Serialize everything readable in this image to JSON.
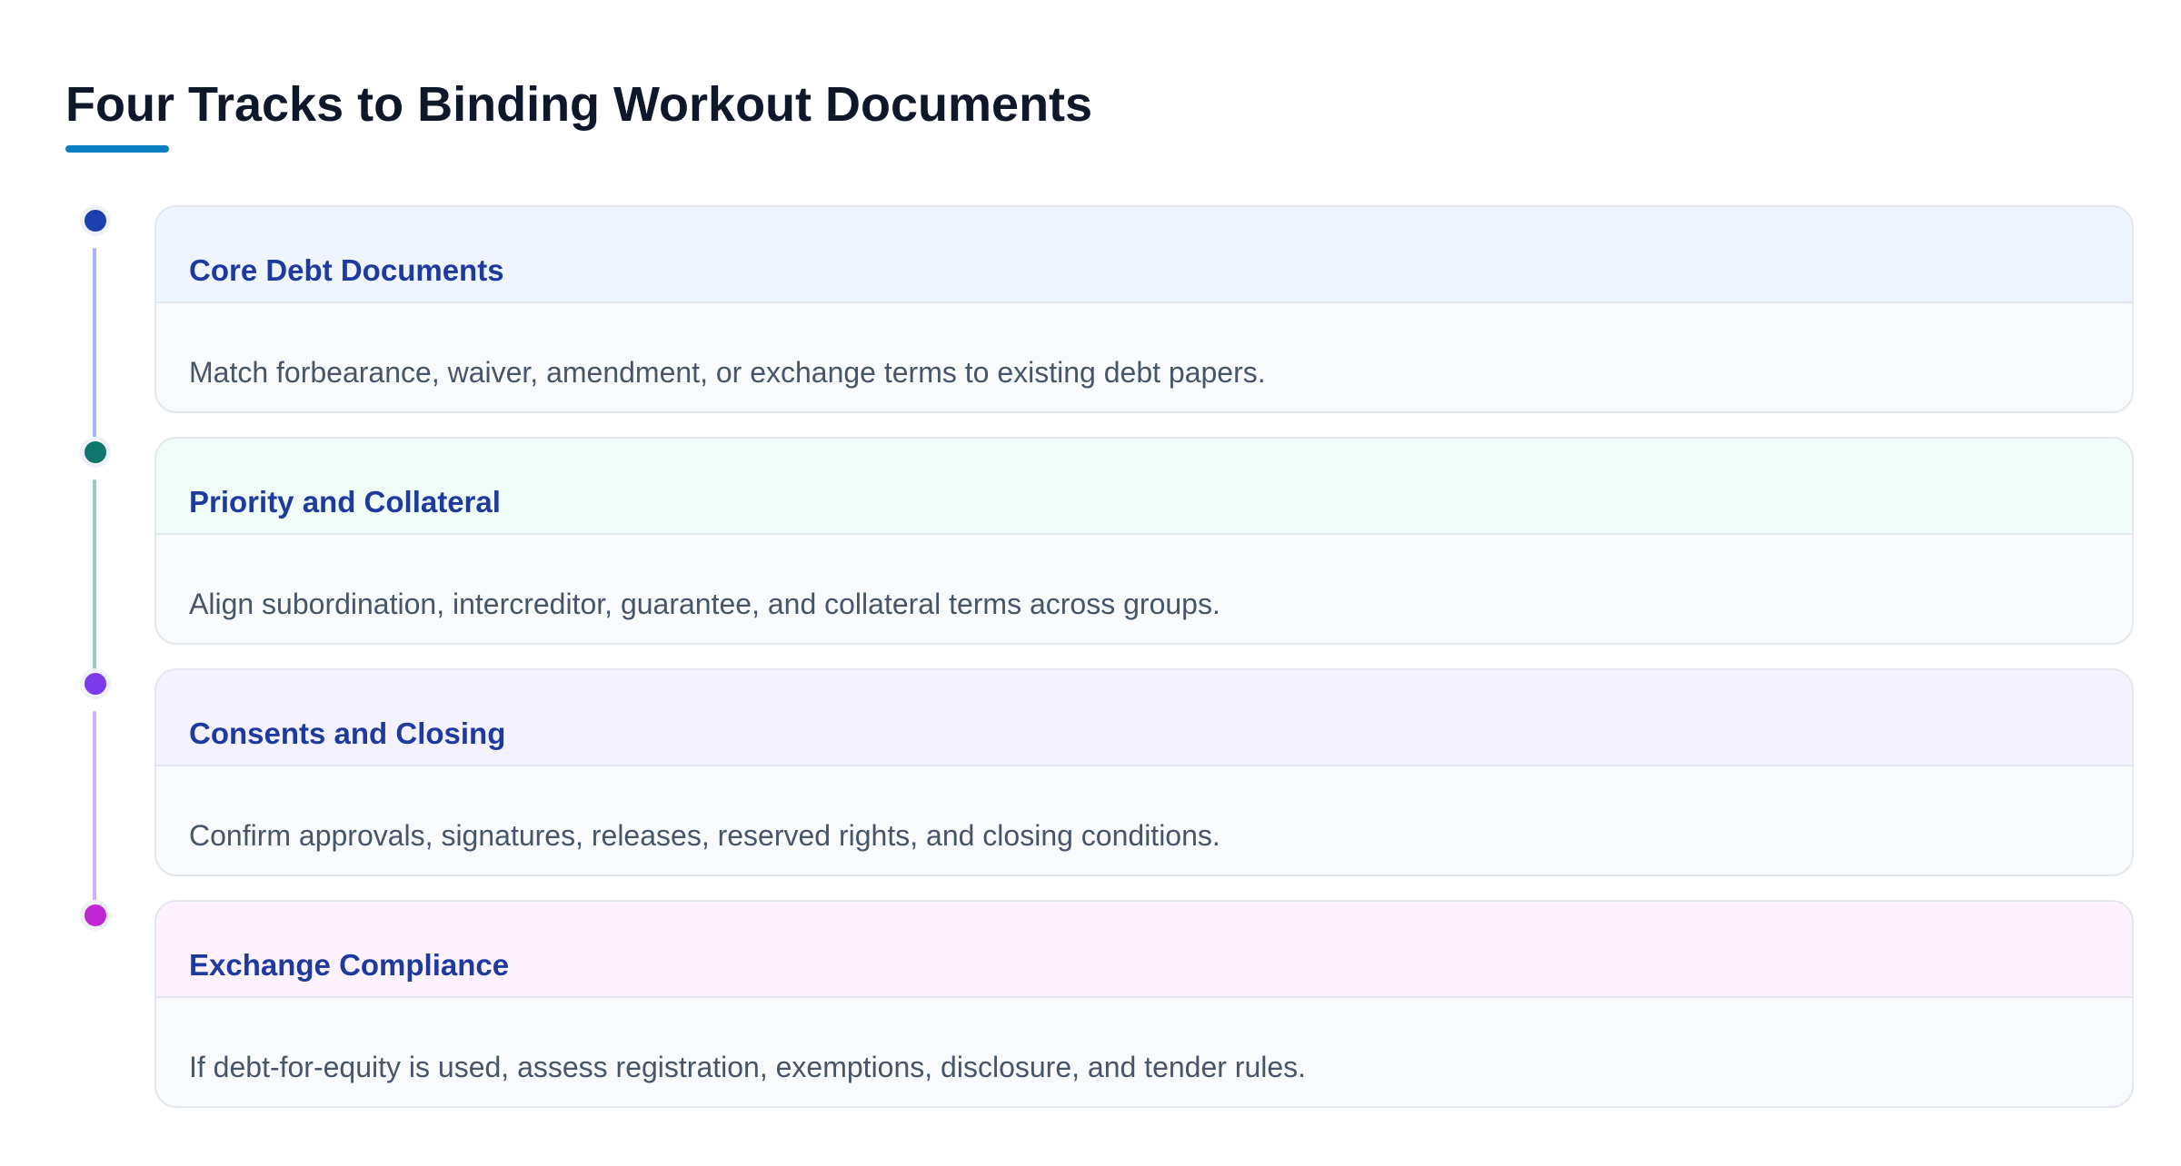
{
  "title": "Four Tracks to Binding Workout Documents",
  "accent_color": "#0a7fc2",
  "tracks": [
    {
      "title": "Core Debt Documents",
      "text": "Match forbearance, waiver, amendment, or exchange terms to existing debt papers.",
      "dot_color": "#1e40af",
      "line_color": "#a5b4fc",
      "head_bg": "#eef5ff"
    },
    {
      "title": "Priority and Collateral",
      "text": "Align subordination, intercreditor, guarantee, and collateral terms across groups.",
      "dot_color": "#0f766e",
      "line_color": "#99c9c2",
      "head_bg": "#effcf8"
    },
    {
      "title": "Consents and Closing",
      "text": "Confirm approvals, signatures, releases, reserved rights, and closing conditions.",
      "dot_color": "#7c3aed",
      "line_color": "#c9b3fb",
      "head_bg": "#f4f2fe"
    },
    {
      "title": "Exchange Compliance",
      "text": "If debt-for-equity is used, assess registration, exemptions, disclosure, and tender rules.",
      "dot_color": "#c026d3",
      "line_color": "#f0abfc",
      "head_bg": "#fdf2fe"
    }
  ]
}
